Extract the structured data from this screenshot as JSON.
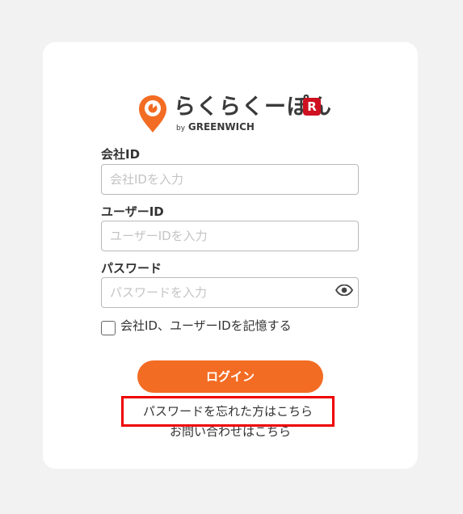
{
  "brand": {
    "name": "らくらくーぽん",
    "by_text": "by",
    "partner": "GREENWICH",
    "badge": "R",
    "accent_color": "#f36c23",
    "badge_color": "#cf1020"
  },
  "form": {
    "company_id": {
      "label": "会社ID",
      "placeholder": "会社IDを入力",
      "value": ""
    },
    "user_id": {
      "label": "ユーザーID",
      "placeholder": "ユーザーIDを入力",
      "value": ""
    },
    "password": {
      "label": "パスワード",
      "placeholder": "パスワードを入力",
      "value": "",
      "toggle_icon": "eye-icon"
    },
    "remember": {
      "label": "会社ID、ユーザーIDを記憶する",
      "checked": false
    },
    "login_label": "ログイン"
  },
  "links": {
    "forgot_password": "パスワードを忘れた方はこちら",
    "contact": "お問い合わせはこちら"
  }
}
